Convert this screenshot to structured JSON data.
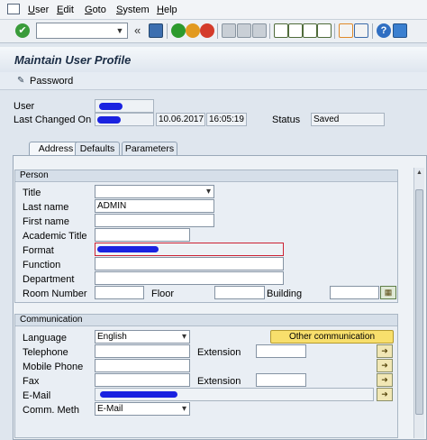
{
  "menubar": {
    "items": [
      {
        "pre": "",
        "ul": "U",
        "post": "ser"
      },
      {
        "pre": "",
        "ul": "E",
        "post": "dit"
      },
      {
        "pre": "",
        "ul": "G",
        "post": "oto"
      },
      {
        "pre": "",
        "ul": "S",
        "post": "ystem"
      },
      {
        "pre": "",
        "ul": "H",
        "post": "elp"
      }
    ]
  },
  "toolbar": {
    "command_field_value": "",
    "back_glyph": "«"
  },
  "title": "Maintain User Profile",
  "app_toolbar": {
    "password_label": "Password"
  },
  "header": {
    "user_label": "User",
    "last_changed_label": "Last Changed On",
    "date": "10.06.2017",
    "time": "16:05:19",
    "status_label": "Status",
    "status_value": "Saved"
  },
  "tabs": {
    "address": "Address",
    "defaults": "Defaults",
    "parameters": "Parameters"
  },
  "person": {
    "title": "Person",
    "title_label": "Title",
    "last_name_label": "Last name",
    "last_name_value": "ADMIN",
    "first_name_label": "First name",
    "academic_title_label": "Academic Title",
    "format_label": "Format",
    "function_label": "Function",
    "department_label": "Department",
    "room_label": "Room Number",
    "floor_label": "Floor",
    "building_label": "Building"
  },
  "communication": {
    "title": "Communication",
    "language_label": "Language",
    "language_value": "English",
    "other_button": "Other communication",
    "telephone_label": "Telephone",
    "extension_label": "Extension",
    "mobile_label": "Mobile Phone",
    "fax_label": "Fax",
    "fax_extension_label": "Extension",
    "email_label": "E-Mail",
    "comm_meth_label": "Comm. Meth",
    "comm_meth_value": "E-Mail"
  },
  "colors": {
    "redaction": "#1a22e0",
    "accent": "#f8df6c"
  }
}
